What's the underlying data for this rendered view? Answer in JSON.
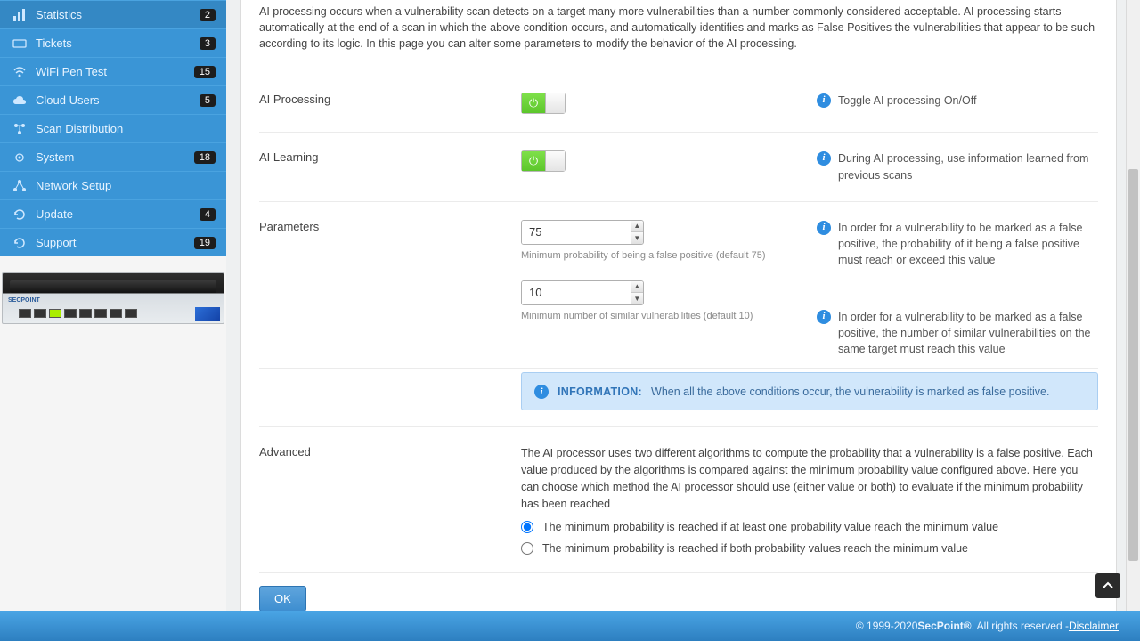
{
  "sidebar": {
    "items": [
      {
        "label": "Statistics",
        "badge": "2",
        "icon": "bars"
      },
      {
        "label": "Tickets",
        "badge": "3",
        "icon": "ticket"
      },
      {
        "label": "WiFi Pen Test",
        "badge": "15",
        "icon": "wifi"
      },
      {
        "label": "Cloud Users",
        "badge": "5",
        "icon": "cloud"
      },
      {
        "label": "Scan Distribution",
        "badge": "",
        "icon": "distribution"
      },
      {
        "label": "System",
        "badge": "18",
        "icon": "gear"
      },
      {
        "label": "Network Setup",
        "badge": "",
        "icon": "network"
      },
      {
        "label": "Update",
        "badge": "4",
        "icon": "refresh"
      },
      {
        "label": "Support",
        "badge": "19",
        "icon": "refresh"
      }
    ]
  },
  "intro": "AI processing occurs when a vulnerability scan detects on a target many more vulnerabilities than a number commonly considered acceptable. AI processing starts automatically at the end of a scan in which the above condition occurs, and automatically identifies and marks as False Positives the vulnerabilities that appear to be such according to its logic. In this page you can alter some parameters to modify the behavior of the AI processing.",
  "sections": {
    "ai_processing": {
      "label": "AI Processing",
      "help": "Toggle AI processing On/Off"
    },
    "ai_learning": {
      "label": "AI Learning",
      "help": "During AI processing, use information learned from previous scans"
    },
    "parameters": {
      "label": "Parameters",
      "min_prob": {
        "value": "75",
        "hint": "Minimum probability of being a false positive (default 75)",
        "help": "In order for a vulnerability to be marked as a false positive, the probability of it being a false positive must reach or exceed this value"
      },
      "min_similar": {
        "value": "10",
        "hint": "Minimum number of similar vulnerabilities (default 10)",
        "help": "In order for a vulnerability to be marked as a false positive, the number of similar vulnerabilities on the same target must reach this value"
      },
      "banner_label": "INFORMATION:",
      "banner_text": "When all the above conditions occur, the vulnerability is marked as false positive."
    },
    "advanced": {
      "label": "Advanced",
      "desc": "The AI processor uses two different algorithms to compute the probability that a vulnerability is a false positive. Each value produced by the algorithms is compared against the minimum probability value configured above. Here you can choose which method the AI processor should use (either value or both) to evaluate if the minimum probability has been reached",
      "opt1": "The minimum probability is reached if at least one probability value reach the minimum value",
      "opt2": "The minimum probability is reached if both probability values reach the minimum value"
    }
  },
  "ok_label": "OK",
  "footer": {
    "copyright": "© 1999-2020 ",
    "brand": "SecPoint®",
    "rights": ". All rights reserved - ",
    "disclaimer": "Disclaimer"
  }
}
